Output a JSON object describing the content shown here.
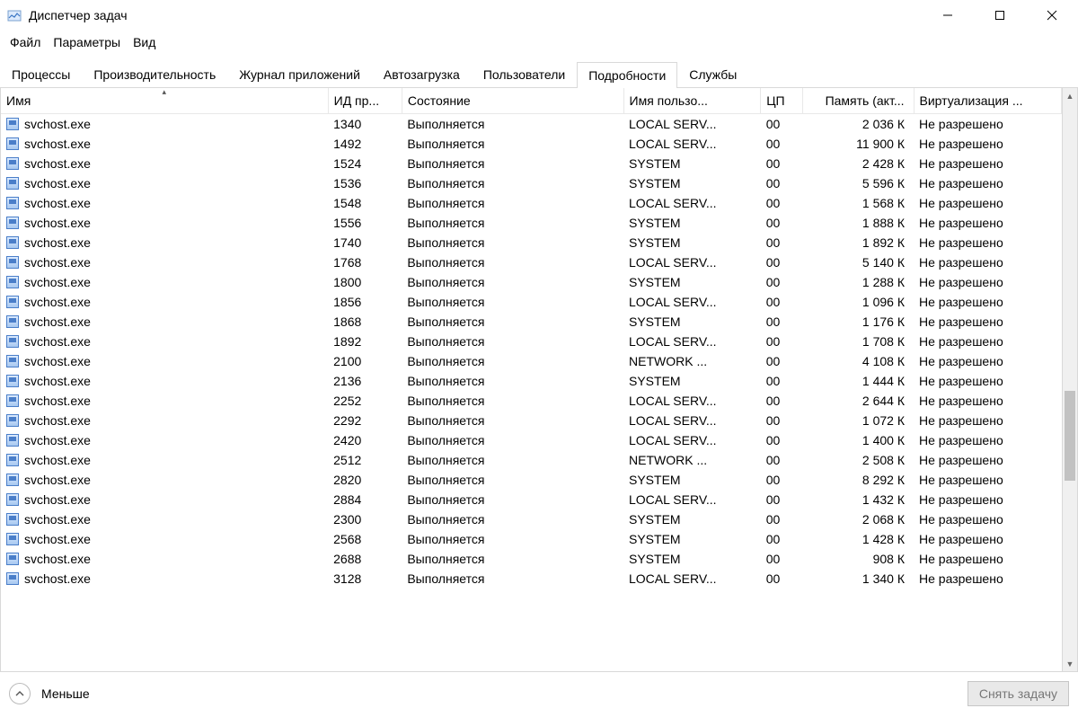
{
  "window": {
    "title": "Диспетчер задач"
  },
  "menu": {
    "file": "Файл",
    "options": "Параметры",
    "view": "Вид"
  },
  "tabs": {
    "processes": "Процессы",
    "performance": "Производительность",
    "app_history": "Журнал приложений",
    "startup": "Автозагрузка",
    "users": "Пользователи",
    "details": "Подробности",
    "services": "Службы"
  },
  "columns": {
    "name": "Имя",
    "pid": "ИД пр...",
    "state": "Состояние",
    "user": "Имя пользо...",
    "cpu": "ЦП",
    "mem": "Память (акт...",
    "virt": "Виртуализация ..."
  },
  "rows": [
    {
      "name": "svchost.exe",
      "pid": "1340",
      "state": "Выполняется",
      "user": "LOCAL SERV...",
      "cpu": "00",
      "mem": "2 036 К",
      "virt": "Не разрешено"
    },
    {
      "name": "svchost.exe",
      "pid": "1492",
      "state": "Выполняется",
      "user": "LOCAL SERV...",
      "cpu": "00",
      "mem": "11 900 К",
      "virt": "Не разрешено"
    },
    {
      "name": "svchost.exe",
      "pid": "1524",
      "state": "Выполняется",
      "user": "SYSTEM",
      "cpu": "00",
      "mem": "2 428 К",
      "virt": "Не разрешено"
    },
    {
      "name": "svchost.exe",
      "pid": "1536",
      "state": "Выполняется",
      "user": "SYSTEM",
      "cpu": "00",
      "mem": "5 596 К",
      "virt": "Не разрешено"
    },
    {
      "name": "svchost.exe",
      "pid": "1548",
      "state": "Выполняется",
      "user": "LOCAL SERV...",
      "cpu": "00",
      "mem": "1 568 К",
      "virt": "Не разрешено"
    },
    {
      "name": "svchost.exe",
      "pid": "1556",
      "state": "Выполняется",
      "user": "SYSTEM",
      "cpu": "00",
      "mem": "1 888 К",
      "virt": "Не разрешено"
    },
    {
      "name": "svchost.exe",
      "pid": "1740",
      "state": "Выполняется",
      "user": "SYSTEM",
      "cpu": "00",
      "mem": "1 892 К",
      "virt": "Не разрешено"
    },
    {
      "name": "svchost.exe",
      "pid": "1768",
      "state": "Выполняется",
      "user": "LOCAL SERV...",
      "cpu": "00",
      "mem": "5 140 К",
      "virt": "Не разрешено"
    },
    {
      "name": "svchost.exe",
      "pid": "1800",
      "state": "Выполняется",
      "user": "SYSTEM",
      "cpu": "00",
      "mem": "1 288 К",
      "virt": "Не разрешено"
    },
    {
      "name": "svchost.exe",
      "pid": "1856",
      "state": "Выполняется",
      "user": "LOCAL SERV...",
      "cpu": "00",
      "mem": "1 096 К",
      "virt": "Не разрешено"
    },
    {
      "name": "svchost.exe",
      "pid": "1868",
      "state": "Выполняется",
      "user": "SYSTEM",
      "cpu": "00",
      "mem": "1 176 К",
      "virt": "Не разрешено"
    },
    {
      "name": "svchost.exe",
      "pid": "1892",
      "state": "Выполняется",
      "user": "LOCAL SERV...",
      "cpu": "00",
      "mem": "1 708 К",
      "virt": "Не разрешено"
    },
    {
      "name": "svchost.exe",
      "pid": "2100",
      "state": "Выполняется",
      "user": "NETWORK ...",
      "cpu": "00",
      "mem": "4 108 К",
      "virt": "Не разрешено"
    },
    {
      "name": "svchost.exe",
      "pid": "2136",
      "state": "Выполняется",
      "user": "SYSTEM",
      "cpu": "00",
      "mem": "1 444 К",
      "virt": "Не разрешено"
    },
    {
      "name": "svchost.exe",
      "pid": "2252",
      "state": "Выполняется",
      "user": "LOCAL SERV...",
      "cpu": "00",
      "mem": "2 644 К",
      "virt": "Не разрешено"
    },
    {
      "name": "svchost.exe",
      "pid": "2292",
      "state": "Выполняется",
      "user": "LOCAL SERV...",
      "cpu": "00",
      "mem": "1 072 К",
      "virt": "Не разрешено"
    },
    {
      "name": "svchost.exe",
      "pid": "2420",
      "state": "Выполняется",
      "user": "LOCAL SERV...",
      "cpu": "00",
      "mem": "1 400 К",
      "virt": "Не разрешено"
    },
    {
      "name": "svchost.exe",
      "pid": "2512",
      "state": "Выполняется",
      "user": "NETWORK ...",
      "cpu": "00",
      "mem": "2 508 К",
      "virt": "Не разрешено"
    },
    {
      "name": "svchost.exe",
      "pid": "2820",
      "state": "Выполняется",
      "user": "SYSTEM",
      "cpu": "00",
      "mem": "8 292 К",
      "virt": "Не разрешено"
    },
    {
      "name": "svchost.exe",
      "pid": "2884",
      "state": "Выполняется",
      "user": "LOCAL SERV...",
      "cpu": "00",
      "mem": "1 432 К",
      "virt": "Не разрешено"
    },
    {
      "name": "svchost.exe",
      "pid": "2300",
      "state": "Выполняется",
      "user": "SYSTEM",
      "cpu": "00",
      "mem": "2 068 К",
      "virt": "Не разрешено"
    },
    {
      "name": "svchost.exe",
      "pid": "2568",
      "state": "Выполняется",
      "user": "SYSTEM",
      "cpu": "00",
      "mem": "1 428 К",
      "virt": "Не разрешено"
    },
    {
      "name": "svchost.exe",
      "pid": "2688",
      "state": "Выполняется",
      "user": "SYSTEM",
      "cpu": "00",
      "mem": "908 К",
      "virt": "Не разрешено"
    },
    {
      "name": "svchost.exe",
      "pid": "3128",
      "state": "Выполняется",
      "user": "LOCAL SERV...",
      "cpu": "00",
      "mem": "1 340 К",
      "virt": "Не разрешено"
    }
  ],
  "footer": {
    "fewer": "Меньше",
    "end_task": "Снять задачу"
  }
}
